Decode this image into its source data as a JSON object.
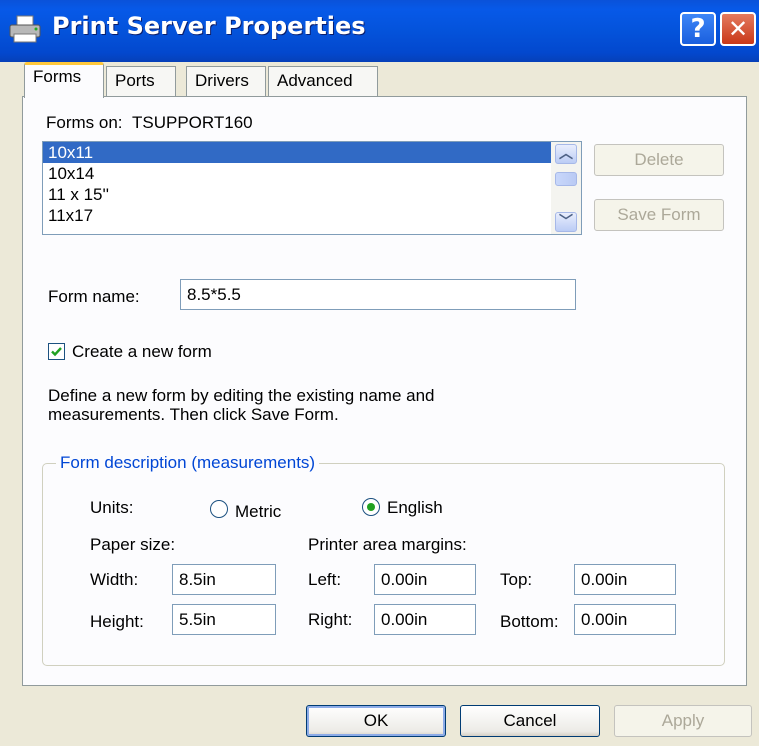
{
  "window": {
    "title": "Print Server Properties",
    "help_glyph": "?",
    "close_glyph": "✕"
  },
  "tabs": [
    {
      "label": "Forms",
      "active": true
    },
    {
      "label": "Ports",
      "active": false
    },
    {
      "label": "Drivers",
      "active": false
    },
    {
      "label": "Advanced",
      "active": false
    }
  ],
  "forms": {
    "forms_on_label": "Forms on:",
    "server_name": "TSUPPORT160",
    "list_items": [
      "10x11",
      "10x14",
      "11 x 15''",
      "11x17"
    ],
    "selected_item": "10x11",
    "delete_button": "Delete",
    "save_form_button": "Save Form",
    "form_name_label": "Form name:",
    "form_name_value": "8.5*5.5",
    "create_new_form_label": "Create a new form",
    "create_new_form_checked": true,
    "description_line1": "Define a new form by editing the existing name and",
    "description_line2": "measurements.  Then click Save Form."
  },
  "measurements": {
    "group_title": "Form description (measurements)",
    "units_label": "Units:",
    "metric_label": "Metric",
    "english_label": "English",
    "selected_unit": "English",
    "paper_size_label": "Paper size:",
    "margins_label": "Printer area margins:",
    "width_label": "Width:",
    "width_value": "8.5in",
    "height_label": "Height:",
    "height_value": "5.5in",
    "left_label": "Left:",
    "left_value": "0.00in",
    "right_label": "Right:",
    "right_value": "0.00in",
    "top_label": "Top:",
    "top_value": "0.00in",
    "bottom_label": "Bottom:",
    "bottom_value": "0.00in"
  },
  "footer": {
    "ok_button": "OK",
    "cancel_button": "Cancel",
    "apply_button": "Apply"
  },
  "colors": {
    "titlebar": "#0453DB",
    "selection": "#316AC5",
    "dialog_bg": "#ECE9D8",
    "group_caption": "#0046D5",
    "checkmark": "#21A121"
  }
}
